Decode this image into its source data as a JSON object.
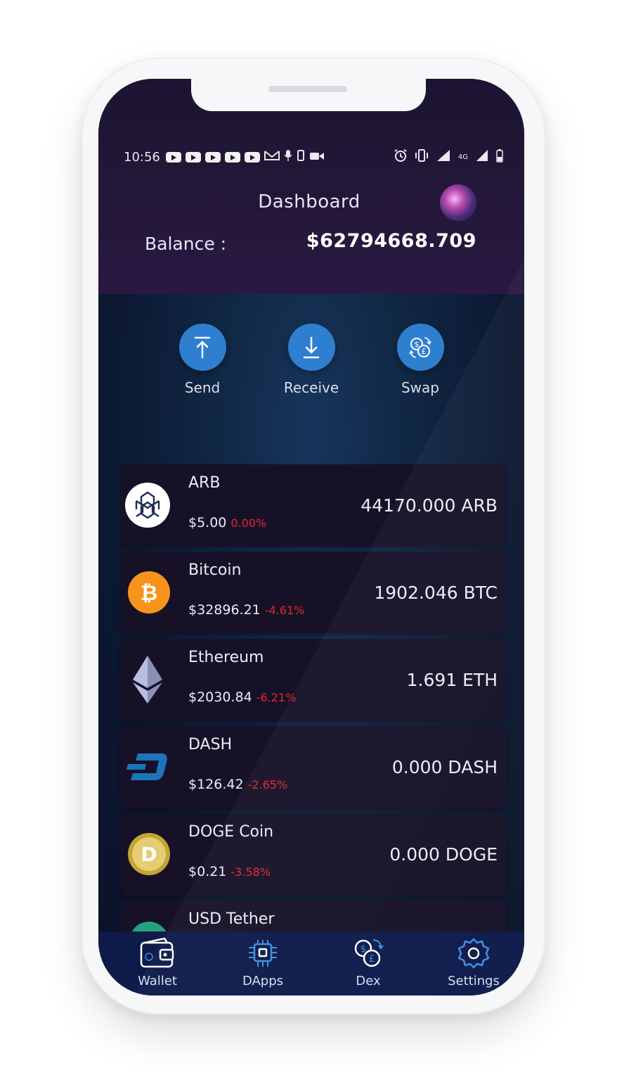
{
  "status_bar": {
    "time": "10:56",
    "network_label": "4G"
  },
  "header": {
    "title": "Dashboard",
    "balance_label": "Balance :",
    "balance_value": "$62794668.709"
  },
  "actions": {
    "send": "Send",
    "receive": "Receive",
    "swap": "Swap"
  },
  "assets": [
    {
      "name": "ARB",
      "price": "$5.00",
      "change": "0.00%",
      "holding": "44170.000 ARB"
    },
    {
      "name": "Bitcoin",
      "price": "$32896.21",
      "change": "-4.61%",
      "holding": "1902.046 BTC"
    },
    {
      "name": "Ethereum",
      "price": "$2030.84",
      "change": "-6.21%",
      "holding": "1.691 ETH"
    },
    {
      "name": "DASH",
      "price": "$126.42",
      "change": "-2.65%",
      "holding": "0.000 DASH"
    },
    {
      "name": "DOGE Coin",
      "price": "$0.21",
      "change": "-3.58%",
      "holding": "0.000 DOGE"
    },
    {
      "name": "USD Tether"
    }
  ],
  "bottom_nav": {
    "wallet": "Wallet",
    "dapps": "DApps",
    "dex": "Dex",
    "settings": "Settings"
  },
  "colors": {
    "accent": "#2f7fd0",
    "negative": "#e0262f",
    "nav_bg": "#0d1a4a",
    "bitcoin": "#f7931a",
    "dash": "#1c75bc",
    "doge": "#c2a633",
    "tether": "#26a17b"
  },
  "icons": [
    "arb-icon",
    "bitcoin-icon",
    "ethereum-icon",
    "dash-icon",
    "doge-icon",
    "tether-icon",
    "send-icon",
    "receive-icon",
    "swap-icon",
    "wallet-icon",
    "dapps-icon",
    "dex-icon",
    "settings-icon"
  ]
}
